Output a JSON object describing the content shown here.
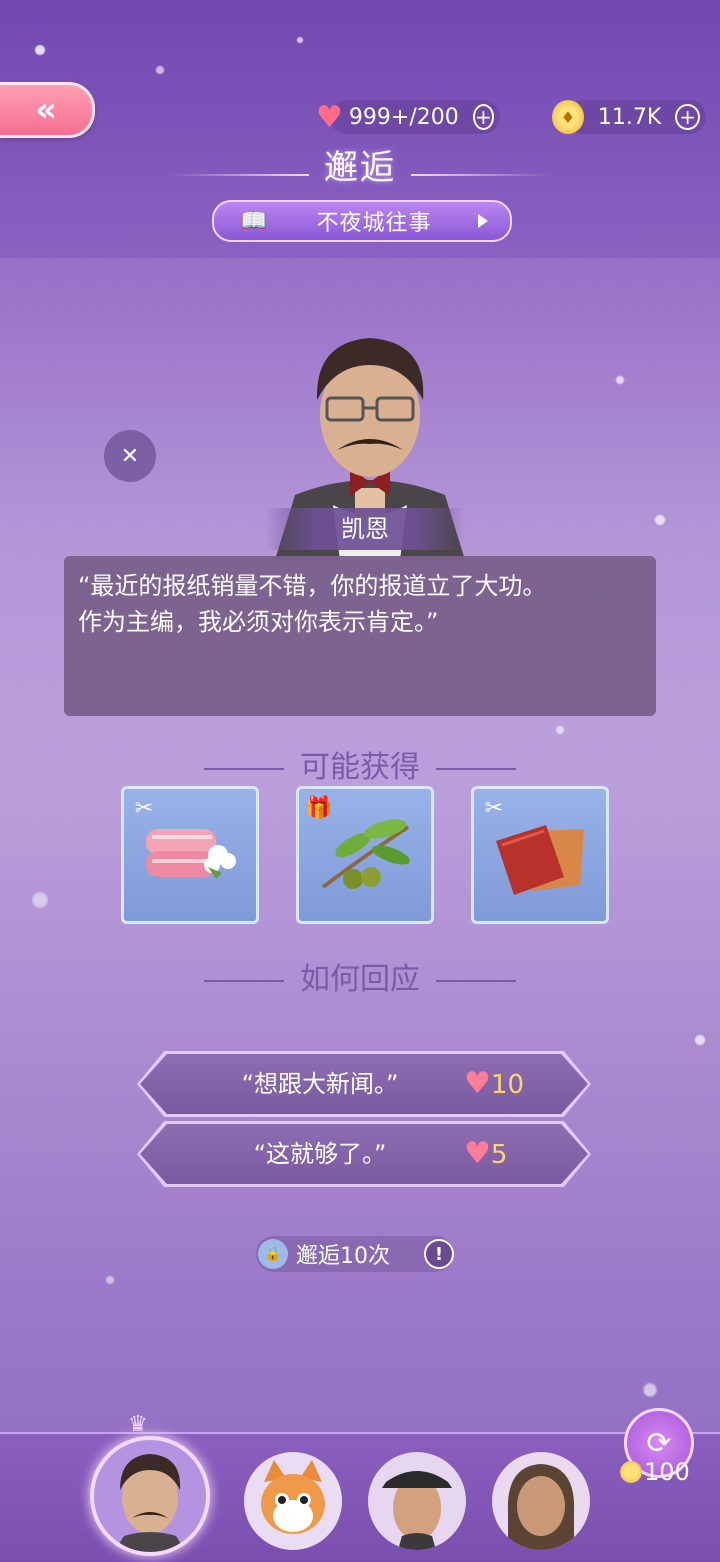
{
  "header": {
    "back_icon": "double-chevron-left-icon",
    "hearts": "999+/200",
    "coins": "11.7K",
    "title": "邂逅",
    "chapter": "不夜城往事"
  },
  "npc": {
    "name": "凯恩",
    "dialogue_line1": "“最近的报纸销量不错，你的报道立了大功。",
    "dialogue_line2": "作为主编，我必须对你表示肯定。”"
  },
  "rewards": {
    "heading": "可能获得",
    "items": [
      {
        "icon": "pink-fabric-cotton-icon",
        "tag": "sewing-tag-icon"
      },
      {
        "icon": "olive-branch-icon",
        "tag": "gift-tag-icon"
      },
      {
        "icon": "red-leather-icon",
        "tag": "sewing-tag-icon"
      }
    ]
  },
  "responses": {
    "heading": "如何回应",
    "options": [
      {
        "text": "“想跟大新闻。”",
        "cost": "10"
      },
      {
        "text": "“这就够了。”",
        "cost": "5"
      }
    ]
  },
  "encounter": {
    "label": "邂逅10次"
  },
  "bottom": {
    "refresh_cost": "100"
  },
  "colors": {
    "accent": "#8b58d6",
    "heart": "#ff6d8a",
    "gold": "#ffd56a"
  }
}
